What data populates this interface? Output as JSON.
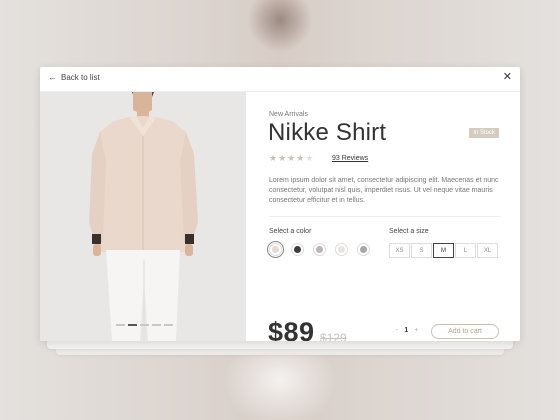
{
  "nav": {
    "back_label": "Back to list",
    "close_icon": "close-icon"
  },
  "product": {
    "category": "New Arrivals",
    "name": "Nikke Shirt",
    "stock_badge": "In Stock",
    "rating": 4,
    "rating_max": 5,
    "reviews_label": "93 Reviews",
    "description": "Lorem ipsum dolor sit amet, consectetur adipiscing elit. Maecenas et nunc consectetur, volutpat nisl quis, imperdiet risus. Ut vel neque vitae mauris consectetur efficitur et in tellus.",
    "price": "$89",
    "old_price": "$129"
  },
  "colors": {
    "label": "Select a color",
    "options": [
      "#e7d9cf",
      "#3e3e3e",
      "#c2b1bb",
      "#ece3df",
      "#a8a5ab"
    ],
    "selected_index": 0
  },
  "sizes": {
    "label": "Select a size",
    "options": [
      "XS",
      "S",
      "M",
      "L",
      "XL"
    ],
    "selected": "M"
  },
  "gallery": {
    "slides": 5,
    "active_index": 1
  },
  "cart": {
    "qty_minus": "-",
    "quantity": "1",
    "qty_plus": "+",
    "add_label": "Add to cart"
  },
  "accent": "#cdbfae"
}
